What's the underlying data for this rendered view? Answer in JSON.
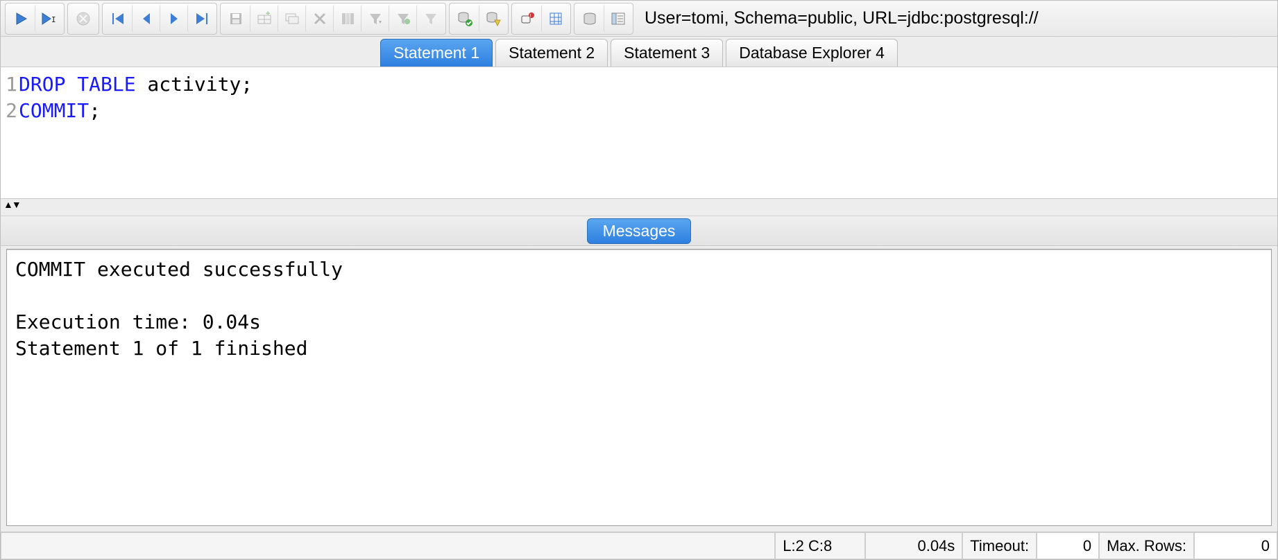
{
  "connection_label": "User=tomi, Schema=public, URL=jdbc:postgresql://",
  "tabs": [
    {
      "label": "Statement 1",
      "active": true
    },
    {
      "label": "Statement 2",
      "active": false
    },
    {
      "label": "Statement 3",
      "active": false
    },
    {
      "label": "Database Explorer 4",
      "active": false
    }
  ],
  "editor": {
    "lines": [
      {
        "n": "1",
        "kw": "DROP TABLE",
        "rest": " activity;"
      },
      {
        "n": "2",
        "kw": "COMMIT",
        "rest": ";"
      }
    ]
  },
  "messages_tab_label": "Messages",
  "messages_text": "COMMIT executed successfully\n\nExecution time: 0.04s\nStatement 1 of 1 finished",
  "statusbar": {
    "cursor": "L:2 C:8",
    "exec_time": "0.04s",
    "timeout_label": "Timeout:",
    "timeout_value": "0",
    "maxrows_label": "Max. Rows:",
    "maxrows_value": "0"
  }
}
